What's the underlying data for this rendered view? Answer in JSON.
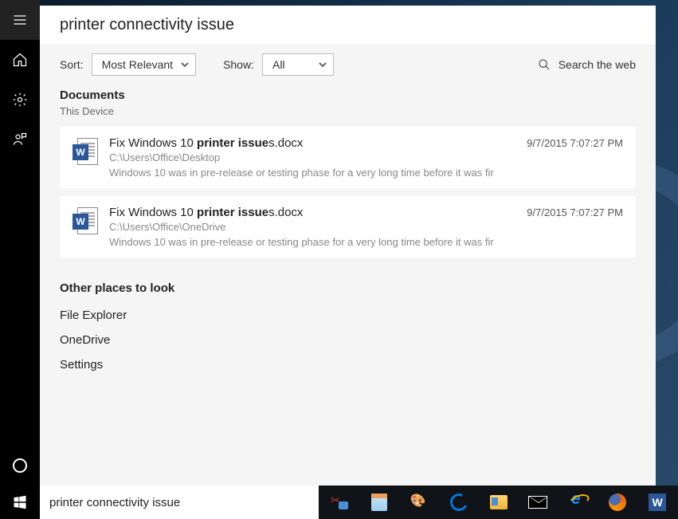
{
  "header": {
    "query": "printer connectivity issue"
  },
  "filters": {
    "sort_label": "Sort:",
    "sort_value": "Most Relevant",
    "show_label": "Show:",
    "show_value": "All",
    "search_web": "Search the web"
  },
  "documents": {
    "heading": "Documents",
    "scope": "This Device",
    "items": [
      {
        "title_pre": "Fix Windows 10 ",
        "title_match": "printer issue",
        "title_post": "s.docx",
        "date": "9/7/2015 7:07:27 PM",
        "path": "C:\\Users\\Office\\Desktop",
        "snippet": "Windows 10 was in pre-release or testing phase for a very long time before it was fir"
      },
      {
        "title_pre": "Fix Windows 10 ",
        "title_match": "printer issue",
        "title_post": "s.docx",
        "date": "9/7/2015 7:07:27 PM",
        "path": "C:\\Users\\Office\\OneDrive",
        "snippet": "Windows 10 was in pre-release or testing phase for a very long time before it was fir"
      }
    ]
  },
  "other": {
    "heading": "Other places to look",
    "links": [
      "File Explorer",
      "OneDrive",
      "Settings"
    ]
  },
  "searchbox": {
    "value": "printer connectivity issue"
  },
  "word_glyph": "W"
}
